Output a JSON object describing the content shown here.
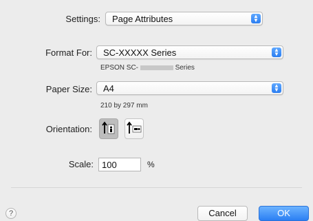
{
  "settings": {
    "label": "Settings:",
    "value": "Page Attributes"
  },
  "format_for": {
    "label": "Format For:",
    "value": "SC-XXXXX Series",
    "subtitle_prefix": "EPSON SC-",
    "subtitle_suffix": "Series"
  },
  "paper_size": {
    "label": "Paper Size:",
    "value": "A4",
    "dimensions": "210 by 297 mm"
  },
  "orientation": {
    "label": "Orientation:",
    "options": [
      "portrait",
      "landscape"
    ],
    "selected": "portrait"
  },
  "scale": {
    "label": "Scale:",
    "value": "100",
    "unit": "%"
  },
  "buttons": {
    "help": "?",
    "cancel": "Cancel",
    "ok": "OK"
  },
  "colors": {
    "accent": "#2b7ff3",
    "background": "#ececec"
  }
}
